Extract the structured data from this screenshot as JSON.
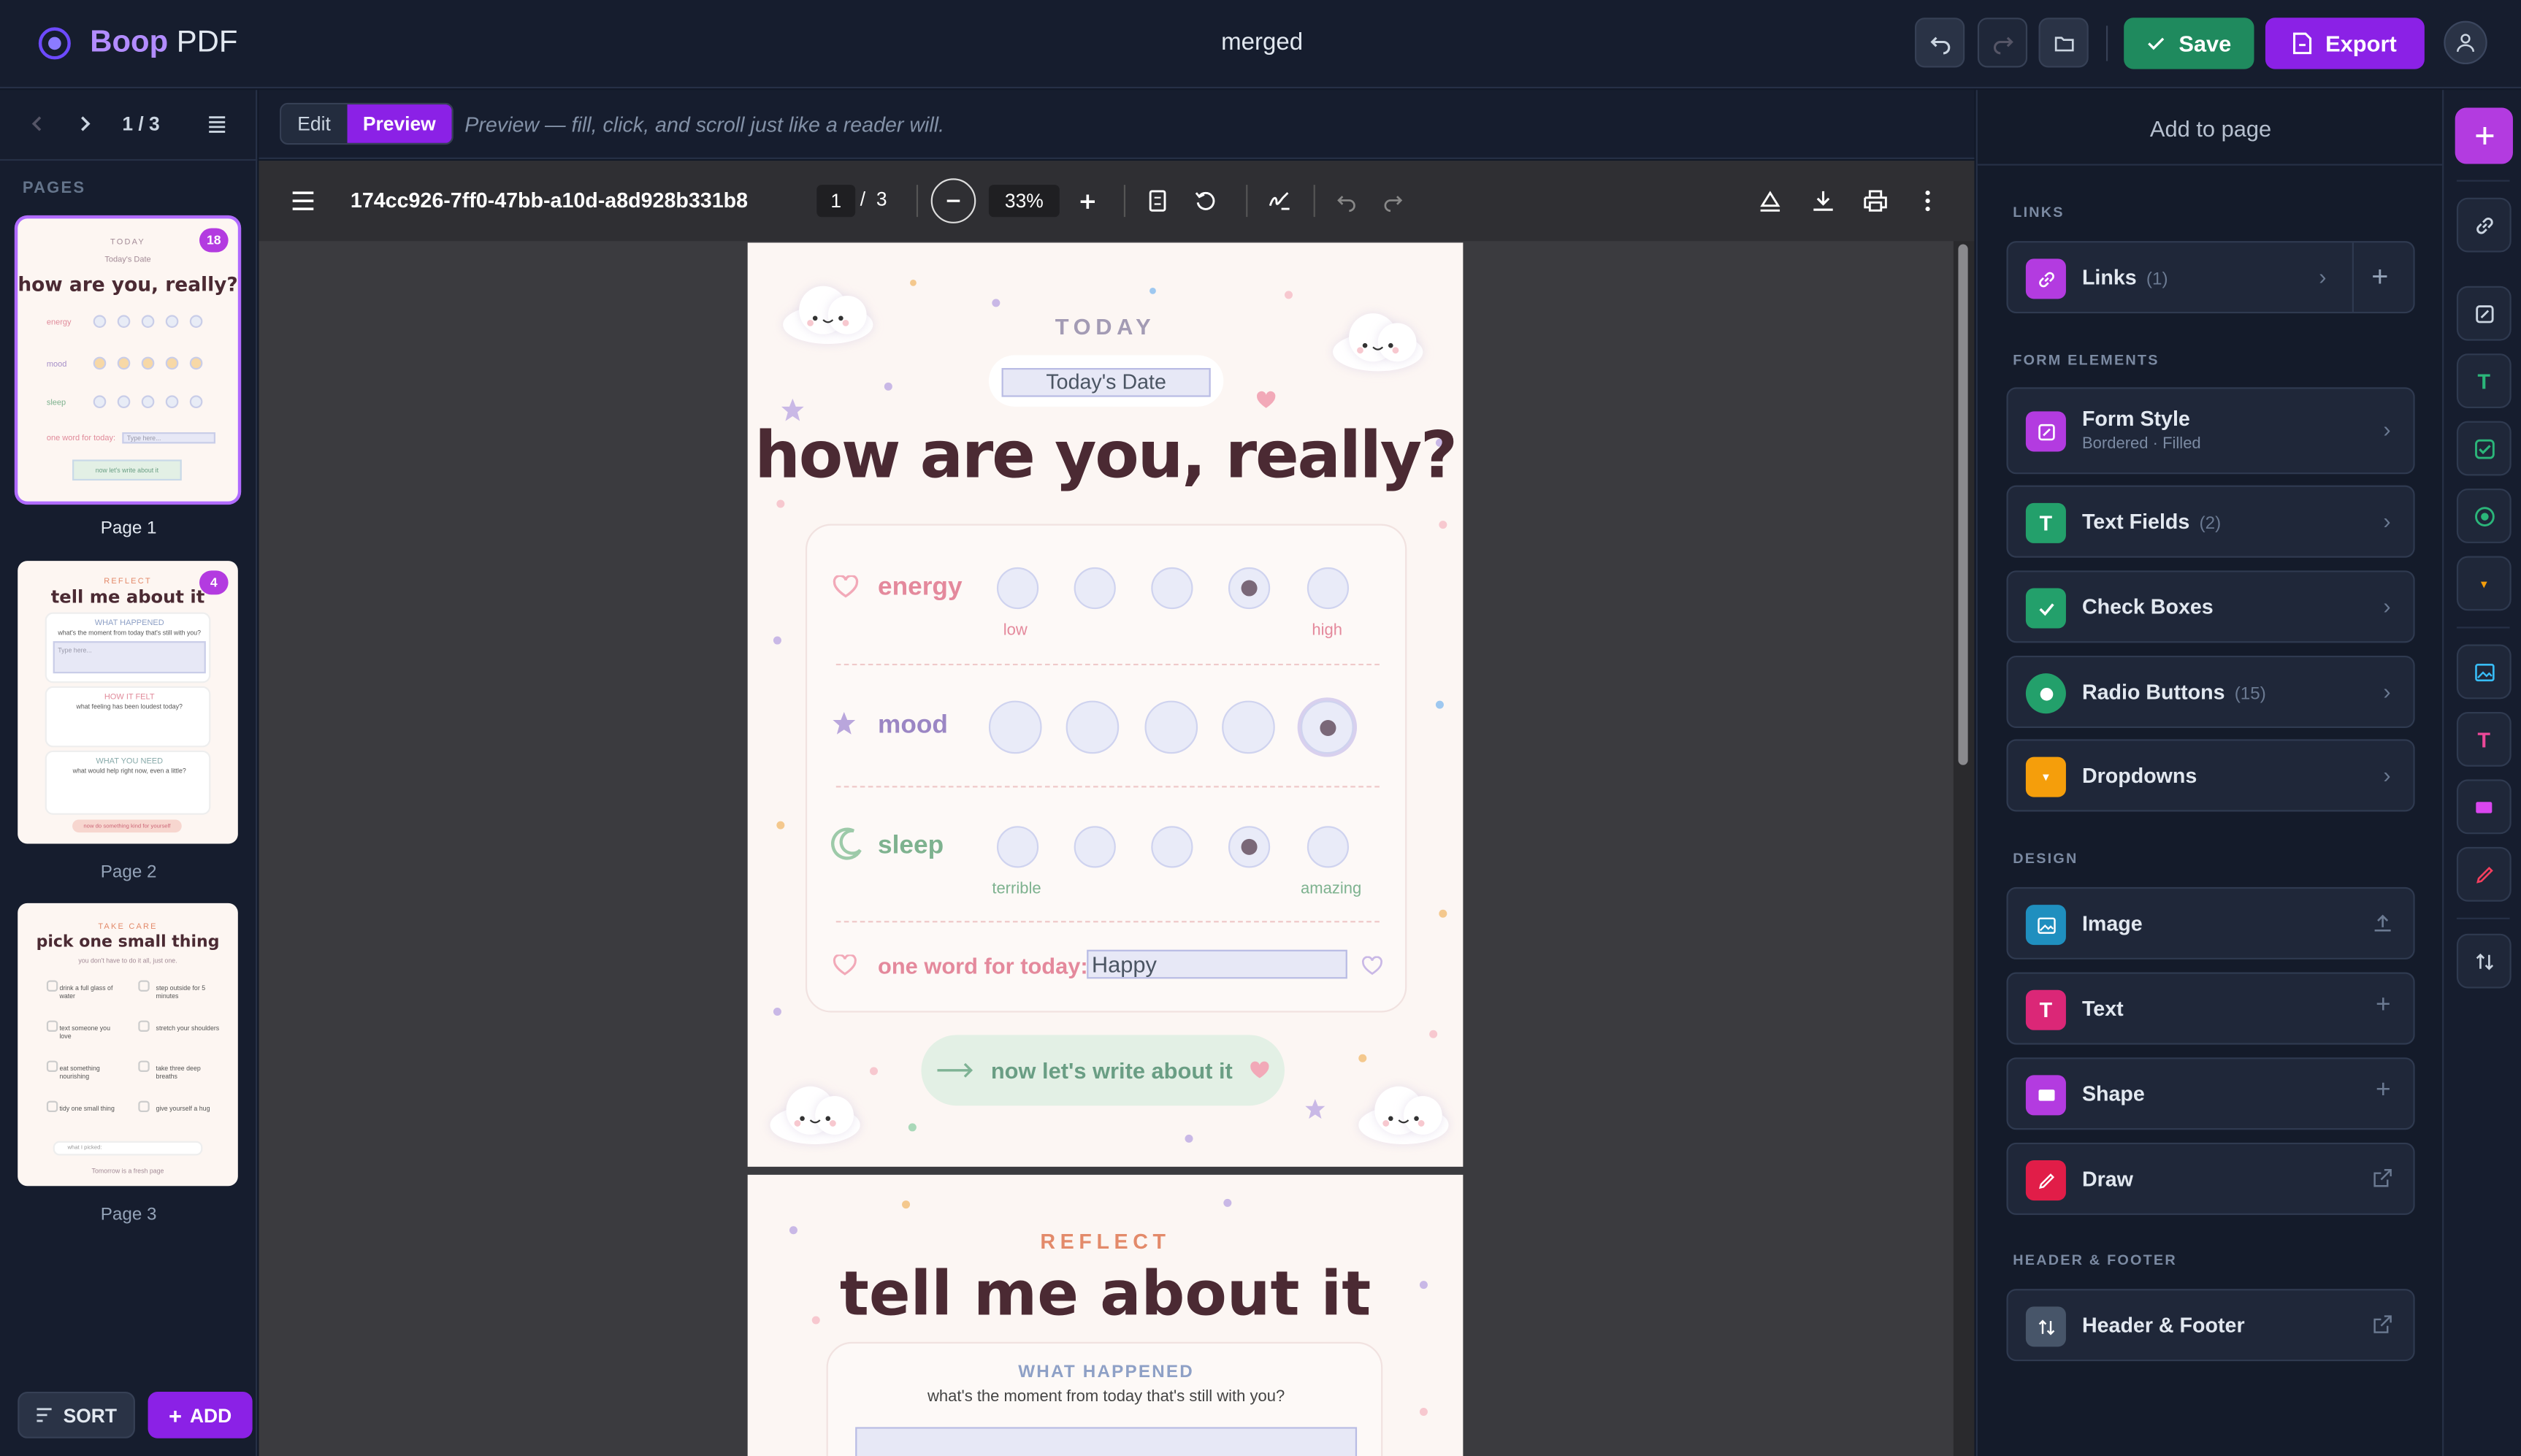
{
  "app": {
    "brand_main": "Boop",
    "brand_sub": " PDF",
    "doc_title": "merged",
    "save_label": "Save",
    "export_label": "Export"
  },
  "sidebar": {
    "page_counter": "1 / 3",
    "pages_label": "PAGES",
    "sort_label": "SORT",
    "add_label": "ADD",
    "pages": [
      {
        "label": "Page 1",
        "badge": "18",
        "title": "how are you, really?",
        "eyebrow": "TODAY",
        "date": "Today's Date",
        "rows": [
          "energy",
          "mood",
          "sleep"
        ],
        "word_label": "one word for today:",
        "word_value": "Type here...",
        "cta": "now let's write about it"
      },
      {
        "label": "Page 2",
        "badge": "4",
        "eyebrow": "REFLECT",
        "title": "tell me about it",
        "s1": "WHAT HAPPENED",
        "s1sub": "what's the moment from today that's still with you?",
        "s1box": "Type here...",
        "s2": "HOW IT FELT",
        "s2sub": "what feeling has been loudest today?",
        "s3": "WHAT YOU NEED",
        "s3sub": "what would help right now, even a little?",
        "cta": "now do something kind for yourself"
      },
      {
        "label": "Page 3",
        "eyebrow": "TAKE CARE",
        "title": "pick one small thing",
        "sub": "you don't have to do it all, just one.",
        "items": [
          "drink a full glass of water",
          "step outside for 5 minutes",
          "text someone you love",
          "stretch your shoulders",
          "eat something nourishing",
          "take three deep breaths",
          "tidy one small thing",
          "give yourself a hug"
        ],
        "picked": "what I picked:",
        "footer": "Tomorrow is a fresh page"
      }
    ]
  },
  "mode": {
    "edit_label": "Edit",
    "preview_label": "Preview",
    "hint": "Preview — fill, click, and scroll just like a reader will."
  },
  "viewer": {
    "filename": "174cc926-7ff0-47bb-a10d-a8d928b331b8",
    "page": "1",
    "total": "3",
    "zoom": "33%"
  },
  "page1": {
    "eyebrow": "TODAY",
    "date_value": "Today's Date",
    "title": "how are you, really?",
    "energy": {
      "label": "energy",
      "low": "low",
      "high": "high",
      "selected": 4
    },
    "mood": {
      "label": "mood",
      "selected": 5
    },
    "sleep": {
      "label": "sleep",
      "low": "terrible",
      "high": "amazing",
      "selected": 4
    },
    "word_label": "one word for today:",
    "word_value": "Happy",
    "cta": "now let's write about it"
  },
  "page2": {
    "eyebrow": "REFLECT",
    "title": "tell me about it",
    "section": "WHAT HAPPENED",
    "sub": "what's the moment from today that's still with you?"
  },
  "panel": {
    "title": "Add to page",
    "sections": {
      "links": "LINKS",
      "form": "FORM ELEMENTS",
      "design": "DESIGN",
      "hf": "HEADER & FOOTER"
    },
    "links": {
      "label": "Links",
      "count": "(1)"
    },
    "form_style": {
      "label": "Form Style",
      "sub": "Bordered · Filled"
    },
    "text_fields": {
      "label": "Text Fields",
      "count": "(2)"
    },
    "check_boxes": {
      "label": "Check Boxes"
    },
    "radio_buttons": {
      "label": "Radio Buttons",
      "count": "(15)"
    },
    "dropdowns": {
      "label": "Dropdowns"
    },
    "image": {
      "label": "Image"
    },
    "text": {
      "label": "Text"
    },
    "shape": {
      "label": "Shape"
    },
    "draw": {
      "label": "Draw"
    },
    "header_footer": {
      "label": "Header & Footer"
    }
  },
  "colors": {
    "accent": "#8b21e6",
    "save": "#1f8a5e",
    "bg": "#111827"
  }
}
